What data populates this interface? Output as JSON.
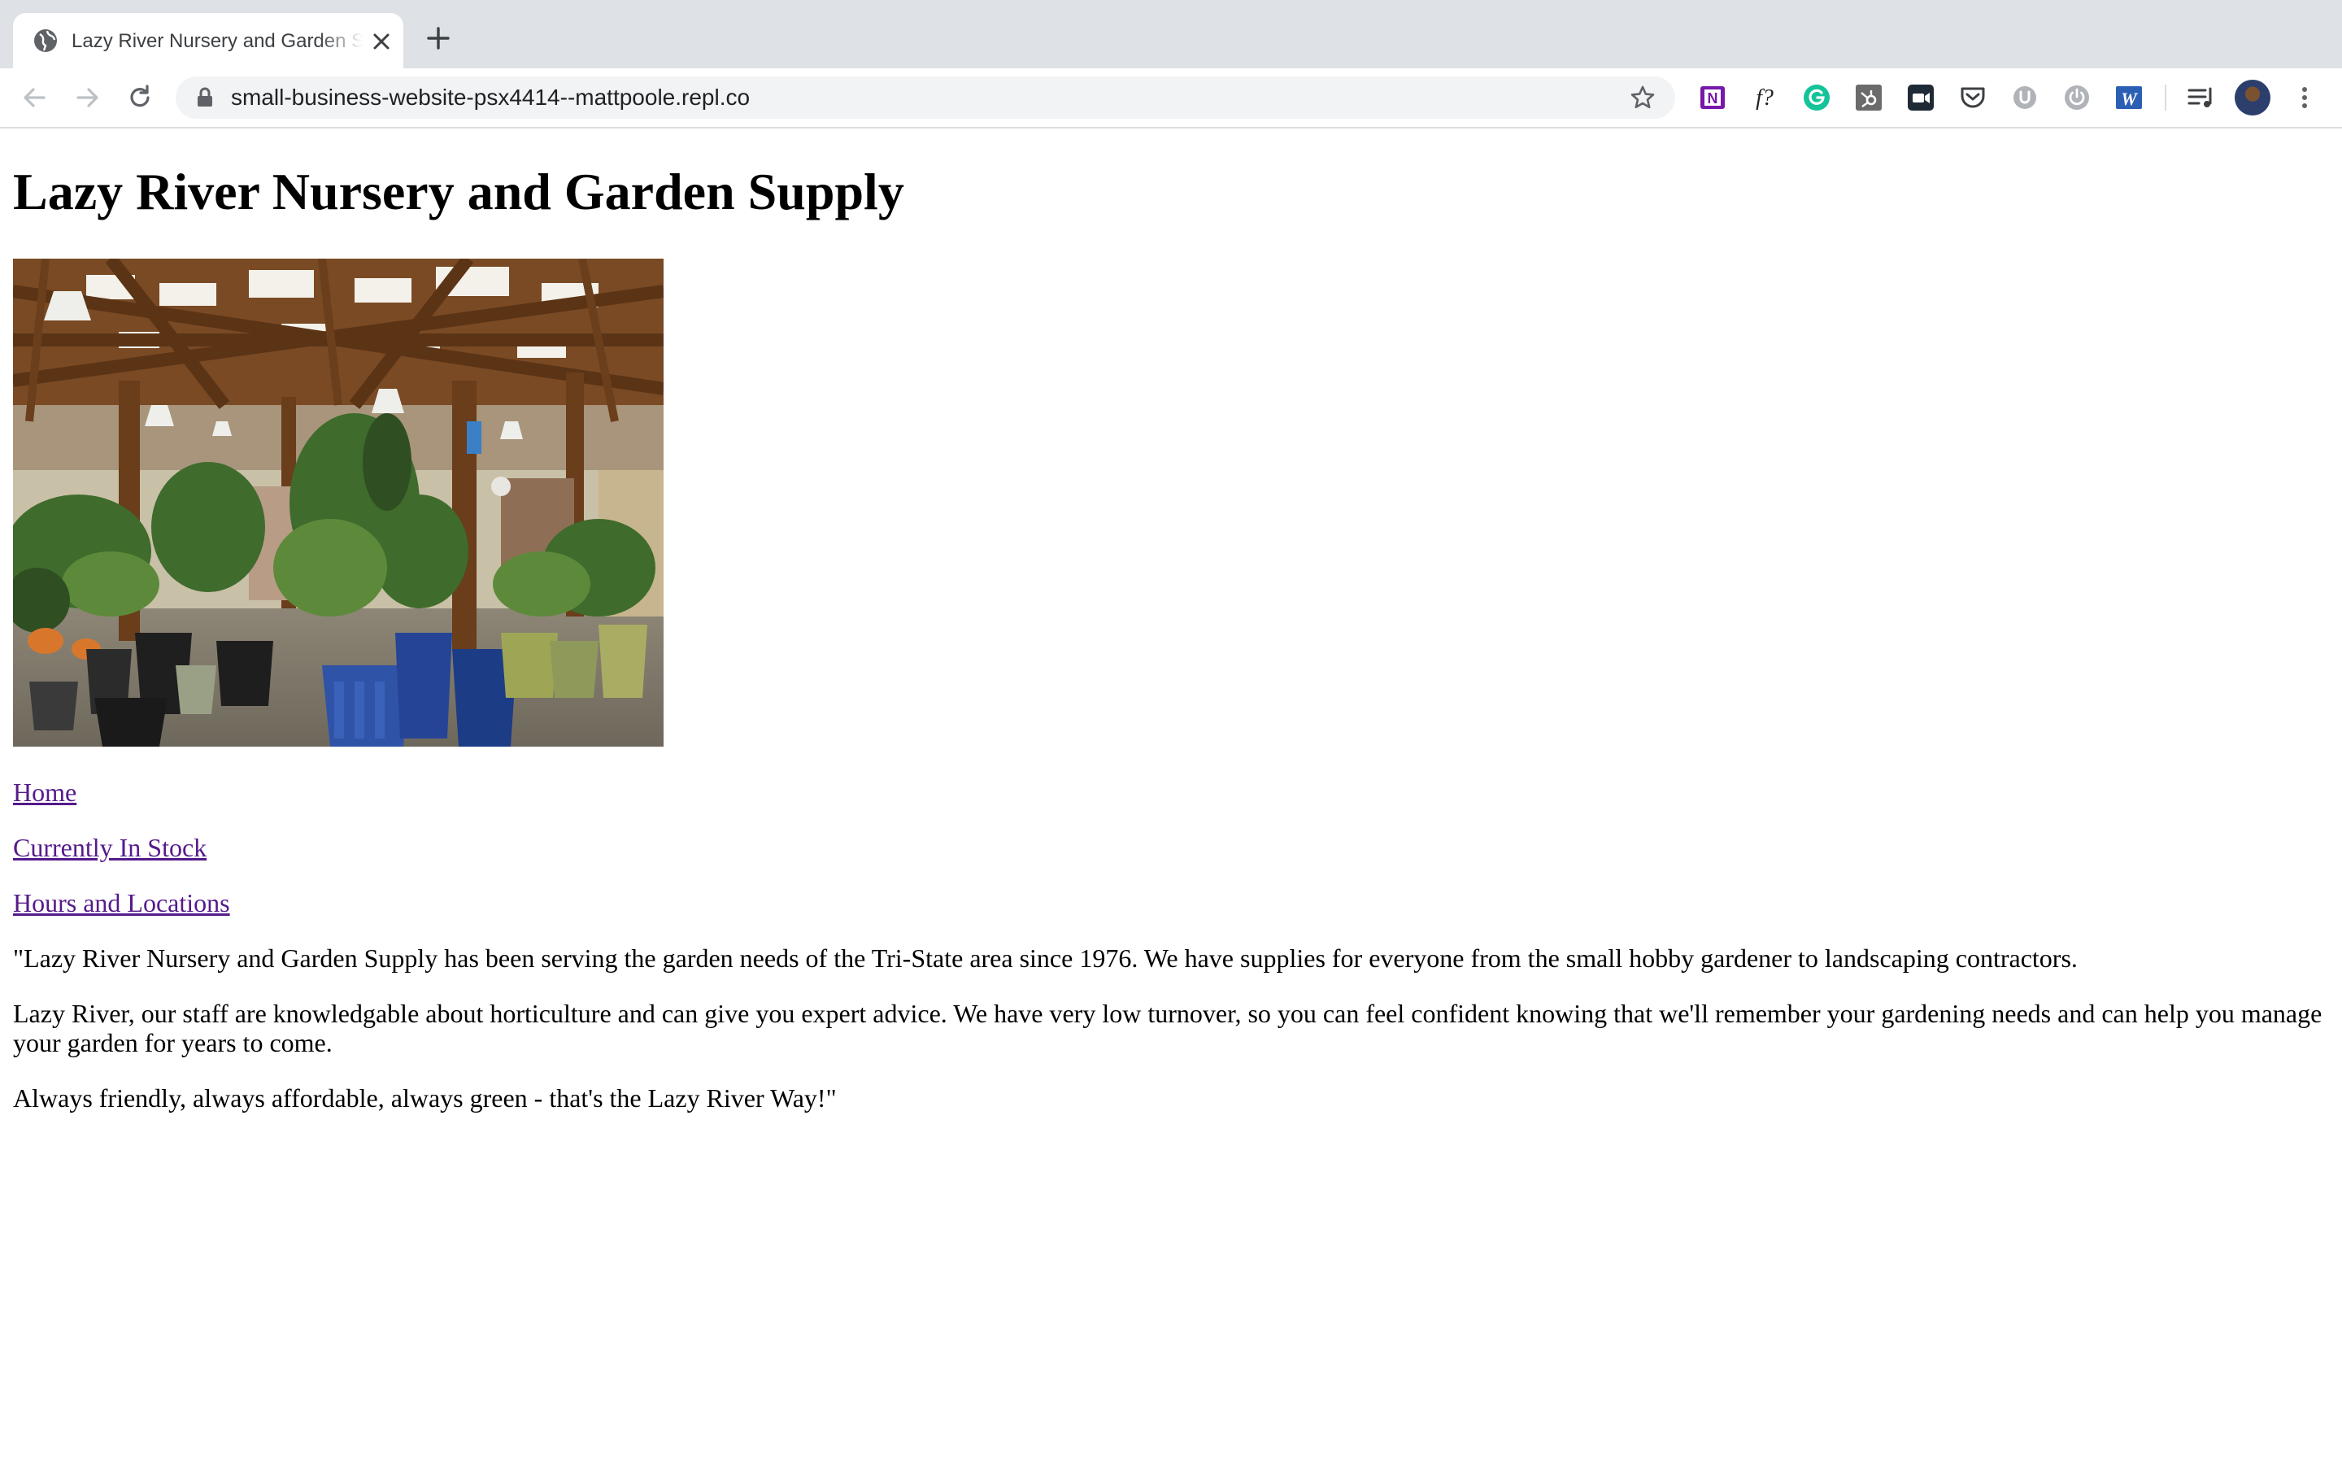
{
  "browser": {
    "tab_title": "Lazy River Nursery and Garden Supply",
    "url": "small-business-website-psx4414--mattpoole.repl.co",
    "extensions": [
      "onenote-icon",
      "font-finder-icon",
      "grammarly-icon",
      "hubspot-icon",
      "zoom-icon",
      "pocket-icon",
      "extension-u-icon",
      "power-icon",
      "word-icon"
    ],
    "extension_labels": {
      "font_finder": "f?",
      "word": "W",
      "onenote": "N"
    }
  },
  "page": {
    "heading": "Lazy River Nursery and Garden Supply",
    "nav": {
      "home": "Home",
      "stock": "Currently In Stock",
      "hours": "Hours and Locations"
    },
    "paragraphs": [
      "\"Lazy River Nursery and Garden Supply has been serving the garden needs of the Tri-State area since 1976. We have supplies for everyone from the small hobby gardener to landscaping contractors.",
      "Lazy River, our staff are knowledgable about horticulture and can give you expert advice. We have very low turnover, so you can feel confident knowing that we'll remember your gardening needs and can help you manage your garden for years to come.",
      "Always friendly, always affordable, always green - that's the Lazy River Way!\""
    ]
  },
  "colors": {
    "link_visited": "#551a8b",
    "tabstrip_bg": "#dee1e6",
    "omnibox_bg": "#f1f3f4"
  }
}
